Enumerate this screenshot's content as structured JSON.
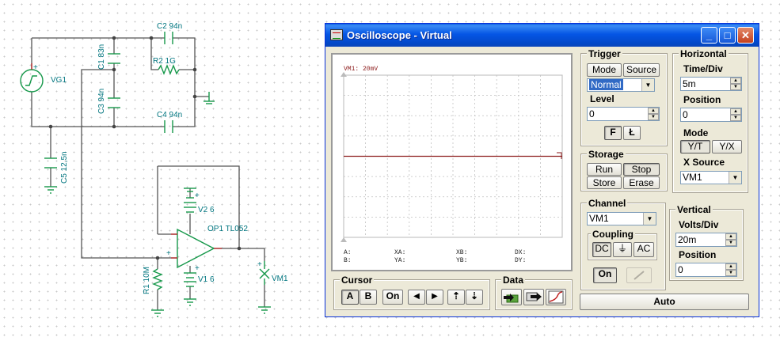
{
  "schematic": {
    "labels": {
      "c2": "C2 94n",
      "c1": "C1 83n",
      "r2": "R2 1G",
      "vg1": "VG1",
      "c3": "C3 94n",
      "c4": "C4 94n",
      "c5": "C5 12,5n",
      "v2": "V2 6",
      "op1": "OP1 TL052",
      "r1": "R1 10M",
      "v1": "V1 6",
      "vm1": "VM1",
      "plus": "+"
    }
  },
  "window": {
    "title": "Oscilloscope - Virtual",
    "buttons": {
      "minimize": "_",
      "maximize": "□",
      "close": "✕"
    }
  },
  "screen": {
    "channel_label": "VM1: 20mV",
    "readouts": {
      "a": "A:",
      "b": "B:",
      "xa": "XA:",
      "ya": "YA:",
      "xb": "XB:",
      "yb": "YB:",
      "dx": "DX:",
      "dy": "DY:"
    },
    "trace_level_fraction": 0.0,
    "trace_color": "#8b1a1a"
  },
  "trigger": {
    "title": "Trigger",
    "mode": "Mode",
    "source": "Source",
    "mode_value": "Normal",
    "level_label": "Level",
    "level_value": "0",
    "edge_rising": "F",
    "edge_falling": "Ł"
  },
  "horizontal": {
    "title": "Horizontal",
    "time_div_label": "Time/Div",
    "time_div_value": "5m",
    "position_label": "Position",
    "position_value": "0",
    "mode_label": "Mode",
    "yt": "Y/T",
    "xy": "Y/X",
    "xsource_label": "X Source",
    "xsource_value": "VM1"
  },
  "storage": {
    "title": "Storage",
    "run": "Run",
    "stop": "Stop",
    "store": "Store",
    "erase": "Erase"
  },
  "channel": {
    "title": "Channel",
    "value": "VM1",
    "coupling_label": "Coupling",
    "dc": "DC",
    "gnd": "⏚",
    "ac": "AC",
    "on": "On"
  },
  "vertical": {
    "title": "Vertical",
    "volts_div_label": "Volts/Div",
    "volts_div_value": "20m",
    "position_label": "Position",
    "position_value": "0"
  },
  "cursor": {
    "title": "Cursor",
    "a": "A",
    "b": "B",
    "on": "On",
    "left": "◀",
    "right": "▶",
    "up": "⇡",
    "down": "⇣"
  },
  "data": {
    "title": "Data"
  },
  "auto": "Auto"
}
